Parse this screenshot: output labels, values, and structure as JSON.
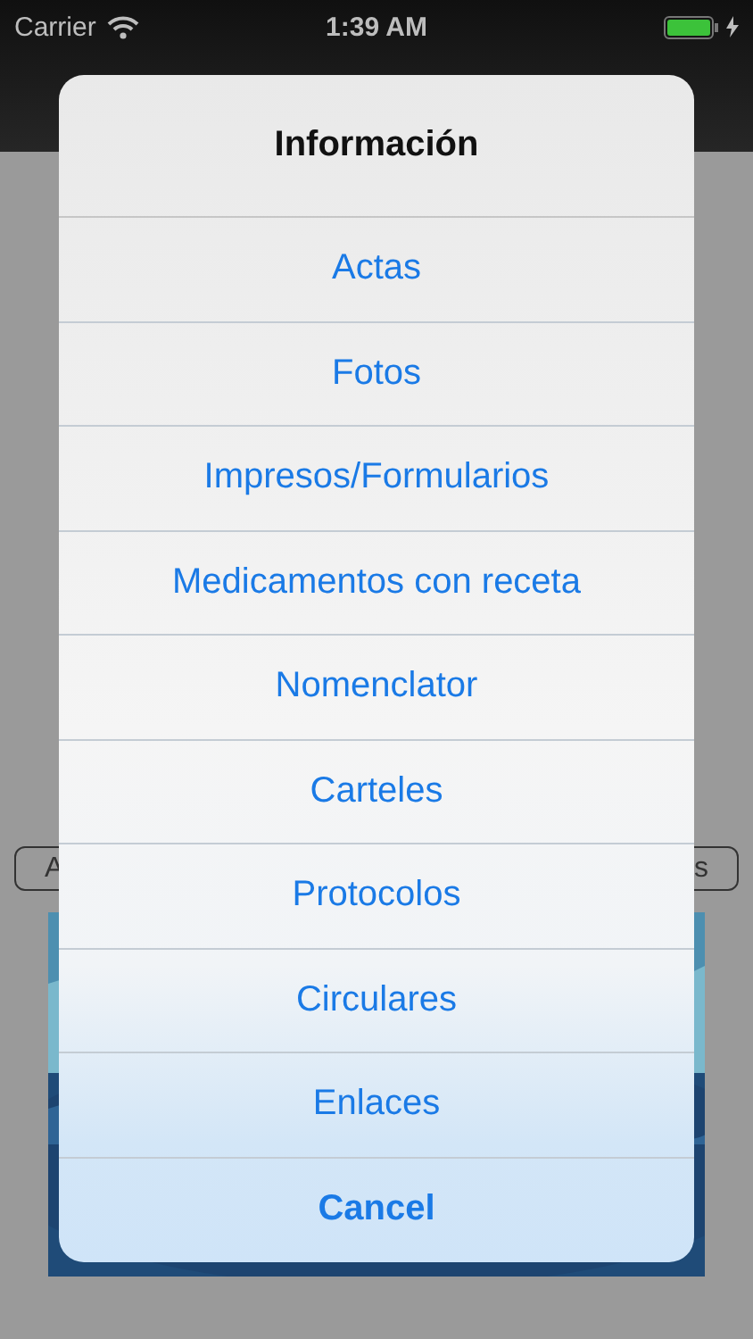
{
  "status_bar": {
    "carrier": "Carrier",
    "time": "1:39 AM",
    "battery_charging": true
  },
  "background_buttons": [
    "A",
    "s"
  ],
  "action_sheet": {
    "title": "Información",
    "actions": [
      {
        "label": "Actas",
        "kind": "default"
      },
      {
        "label": "Fotos",
        "kind": "default"
      },
      {
        "label": "Impresos/Formularios",
        "kind": "default"
      },
      {
        "label": "Medicamentos con receta",
        "kind": "default"
      },
      {
        "label": "Nomenclator",
        "kind": "default"
      },
      {
        "label": "Carteles",
        "kind": "default"
      },
      {
        "label": "Protocolos",
        "kind": "default"
      },
      {
        "label": "Circulares",
        "kind": "default"
      },
      {
        "label": "Enlaces",
        "kind": "default"
      },
      {
        "label": "Cancel",
        "kind": "cancel"
      }
    ]
  }
}
